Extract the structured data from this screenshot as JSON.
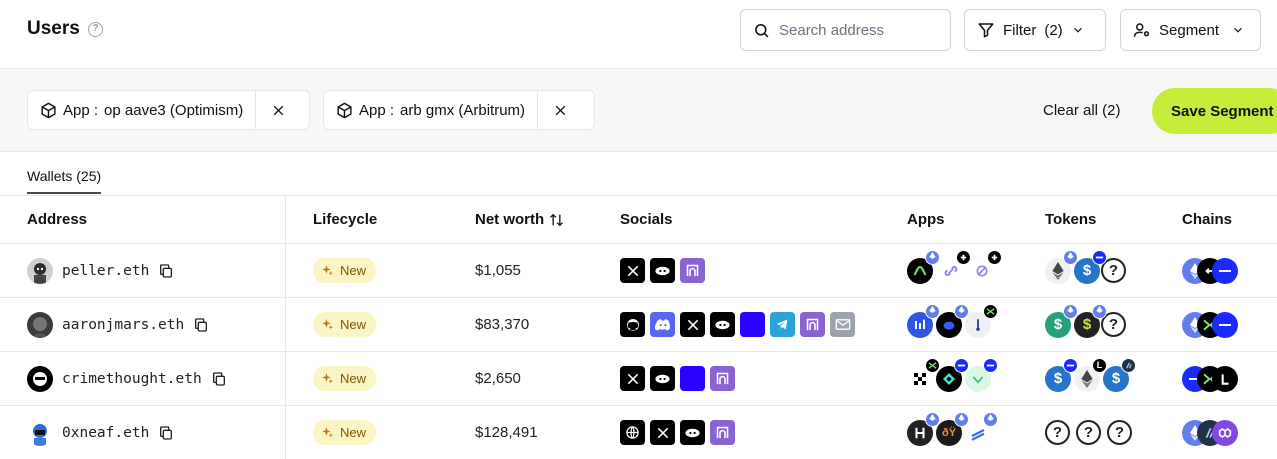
{
  "header": {
    "title": "Users",
    "help_glyph": "?",
    "search_placeholder": "Search address",
    "filter_label": "Filter",
    "filter_count": "(2)",
    "segment_label": "Segment"
  },
  "filters": {
    "chips": [
      {
        "key": "App :",
        "value": "op aave3 (Optimism)"
      },
      {
        "key": "App :",
        "value": "arb gmx (Arbitrum)"
      }
    ],
    "clear_all": "Clear all (2)",
    "save_segment": "Save Segment"
  },
  "tabs": {
    "wallets": "Wallets (25)"
  },
  "table": {
    "columns": [
      "Address",
      "Lifecycle",
      "Net worth",
      "Socials",
      "Apps",
      "Tokens",
      "Chains"
    ],
    "rows": [
      {
        "address": "peller.eth",
        "lifecycle": "New",
        "net_worth": "$1,055",
        "socials": [
          "x-icon",
          "lens-icon",
          "farcaster-icon"
        ],
        "apps": [
          "app-green-icon",
          "app-purple-link-icon",
          "app-link-icon"
        ],
        "tokens": [
          "eth-token-icon",
          "usdc-token-icon",
          "unknown-token-icon"
        ],
        "chains": [
          "ethereum-chain-icon",
          "linea-chain-icon",
          "base-chain-icon"
        ]
      },
      {
        "address": "aaronjmars.eth",
        "lifecycle": "New",
        "net_worth": "$83,370",
        "socials": [
          "github-icon",
          "discord-icon",
          "x-icon",
          "lens-icon",
          "blue-square-icon",
          "telegram-icon",
          "farcaster-icon",
          "email-icon"
        ],
        "apps": [
          "app-chart-icon",
          "app-blob-icon",
          "app-pin-icon"
        ],
        "tokens": [
          "usdt-token-icon",
          "dollar-token-icon",
          "unknown-token-icon"
        ],
        "chains": [
          "ethereum-chain-icon",
          "mode-chain-icon",
          "base-chain-icon"
        ]
      },
      {
        "address": "crimethought.eth",
        "lifecycle": "New",
        "net_worth": "$2,650",
        "socials": [
          "x-icon",
          "lens-icon",
          "blue-square-icon",
          "farcaster-icon"
        ],
        "apps": [
          "app-okx-icon",
          "app-mode-icon",
          "app-green-logo-icon"
        ],
        "tokens": [
          "usdc-token-icon",
          "eth-token-icon",
          "usdc-token-icon"
        ],
        "chains": [
          "base-chain-icon",
          "mode-chain-icon",
          "linea-l-chain-icon"
        ]
      },
      {
        "address": "0xneaf.eth",
        "lifecycle": "New",
        "net_worth": "$128,491",
        "socials": [
          "globe-icon",
          "x-icon",
          "lens-icon",
          "farcaster-icon"
        ],
        "apps": [
          "app-h-icon",
          "app-orange-icon",
          "app-stripes-icon"
        ],
        "tokens": [
          "unknown-token-icon",
          "unknown-token-icon",
          "unknown-token-icon"
        ],
        "chains": [
          "ethereum-chain-icon",
          "arbitrum-chain-icon",
          "polygon-chain-icon"
        ]
      }
    ]
  },
  "colors": {
    "accent": "#c5ee3a",
    "badge_bg": "#fbf4c4",
    "badge_text": "#7a5a00",
    "base_blue": "#0052ff",
    "farcaster_purple": "#8a63d2"
  }
}
